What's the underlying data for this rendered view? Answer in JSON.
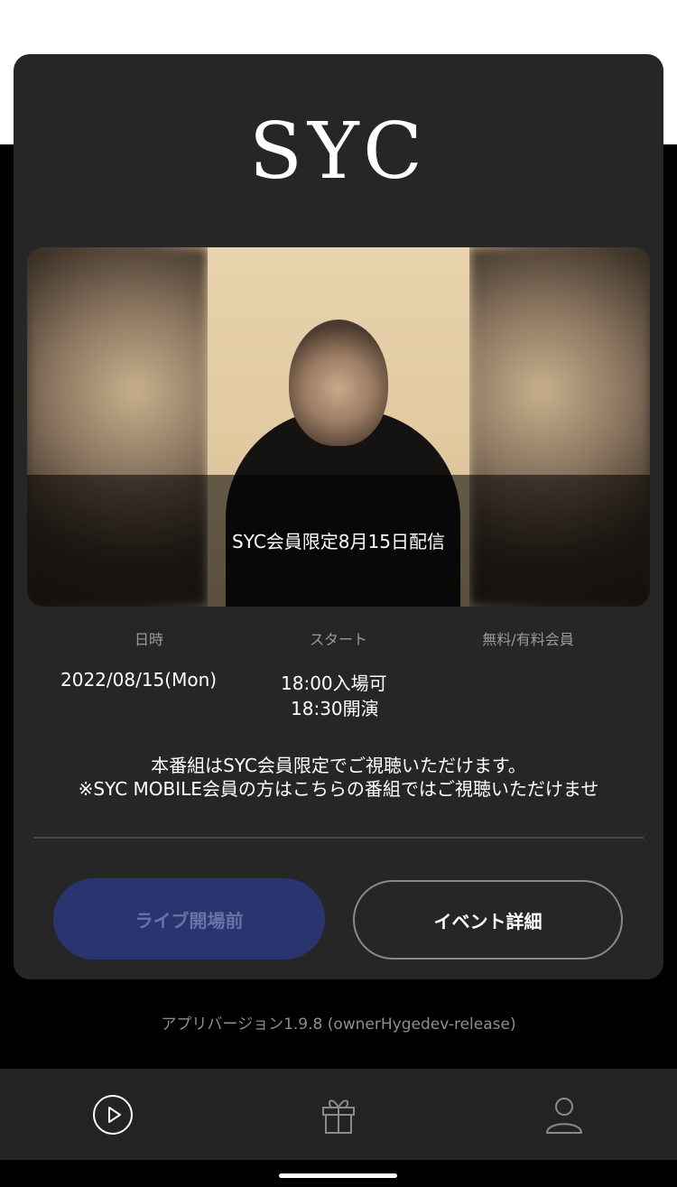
{
  "header": {
    "logo_text": "SYC"
  },
  "banner": {
    "caption": "SYC会員限定8月15日配信"
  },
  "info": {
    "headers": [
      "日時",
      "スタート",
      "無料/有料会員"
    ],
    "date": "2022/08/15(Mon)",
    "start_line1": "18:00入場可",
    "start_line2": "18:30開演"
  },
  "notice": {
    "line1": "本番組はSYC会員限定でご視聴いただけます。",
    "line2": "※SYC MOBILE会員の方はこちらの番組ではご視聴いただけませ"
  },
  "buttons": {
    "live_label": "ライブ開場前",
    "event_label": "イベント詳細"
  },
  "footer": {
    "version_text": "アプリバージョン1.9.8 (ownerHygedev-release)"
  },
  "tabbar": {
    "items": [
      "play-icon",
      "gift-icon",
      "profile-icon"
    ]
  },
  "colors": {
    "card_bg": "#262626",
    "live_button_bg": "#2a3570",
    "tabbar_bg": "#232323"
  }
}
